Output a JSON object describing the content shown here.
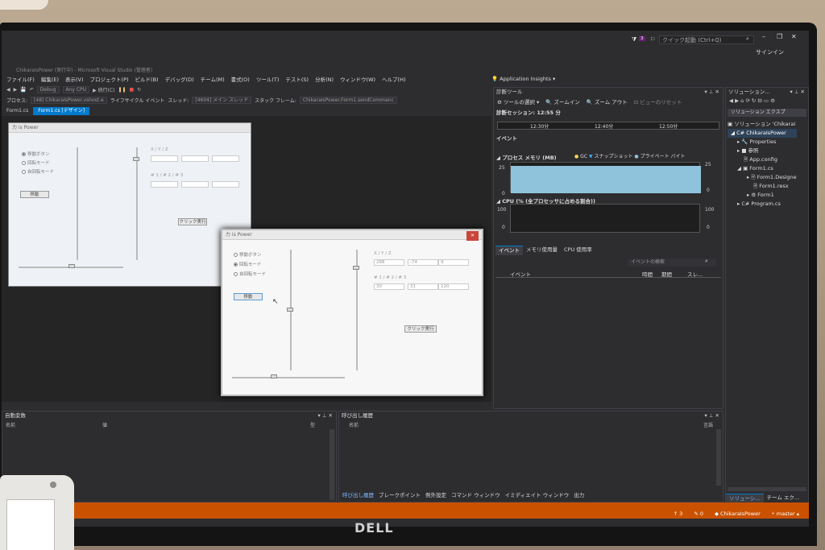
{
  "window": {
    "title": "ChikaraIsPower (実行中) - Microsoft Visual Studio (管理者)",
    "quick_launch_placeholder": "クイック起動 (Ctrl+Q)",
    "notification_count": "3",
    "signin": "サインイン",
    "controls": [
      "–",
      "❐",
      "✕"
    ]
  },
  "menu": [
    "ファイル(F)",
    "編集(E)",
    "表示(V)",
    "プロジェクト(P)",
    "ビルド(B)",
    "デバッグ(D)",
    "チーム(M)",
    "書式(O)",
    "ツール(T)",
    "テスト(S)",
    "分析(N)",
    "ウィンドウ(W)",
    "ヘルプ(H)"
  ],
  "toolbar": {
    "config": "Debug",
    "platform": "Any CPU",
    "continue": "続行(C)",
    "app_insights": "Application Insights"
  },
  "process_bar": {
    "process_label": "プロセス:",
    "process_value": "[48] ChikaraIsPower.vshost.e",
    "lifecycle": "ライフサイクル イベント",
    "thread_label": "スレッド:",
    "thread_value": "[4604] メイン スレッド",
    "stack_label": "スタック フレーム:",
    "stack_value": "ChikaraIsPower.Form1.sendCommanc"
  },
  "tabs": [
    {
      "label": "Form1.cs",
      "active": false
    },
    {
      "label": "Form1.cs [デザイン]",
      "active": true
    }
  ],
  "form_designer": {
    "caption": "力 is Power",
    "radios": [
      "移動ボタン",
      "回転モード",
      "自回転モード"
    ],
    "button_move": "移動",
    "button_click": "クリック実行",
    "label_xyz": "X / Y / Z",
    "label_123": "# 1 / # 2 / # 3"
  },
  "form_running": {
    "caption": "力 is Power",
    "radios": [
      "移動ボタン",
      "回転モード",
      "自回転モード"
    ],
    "button_move": "移動",
    "button_click": "クリック実行",
    "label_xyz": "X / Y / Z",
    "label_123": "# 1 / # 2 / # 3",
    "xyz_values": [
      "288",
      "-74",
      "9"
    ],
    "n_values": [
      "30",
      "31",
      "120"
    ]
  },
  "diagnostics": {
    "title": "診断ツール",
    "tool_select": "ツールの選択",
    "zoom_in": "ズームイン",
    "zoom_out": "ズーム アウト",
    "reset_view": "ビューのリセット",
    "session": "診断セッション: 12:55 分",
    "timeline": [
      "12:30分",
      "12:40分",
      "12:50分"
    ],
    "events_section": "イベント",
    "memory_section": "プロセス メモリ (MB)",
    "legend_gc": "GC",
    "legend_snapshot": "スナップショット",
    "legend_private": "プライベート バイト",
    "mem_max": "25",
    "mem_min": "0",
    "cpu_section": "CPU (% (全プロセッサに占める割合))",
    "cpu_max": "100",
    "cpu_min": "0",
    "subtabs": [
      "イベント",
      "メモリ使用量",
      "CPU 使用率"
    ],
    "search_placeholder": "イベントの検索",
    "columns": [
      "イベント",
      "時間",
      "期間",
      "スレ..."
    ]
  },
  "solution_explorer": {
    "title": "ソリューション...",
    "search_title": "ソリューション エクスプ",
    "items": [
      "ソリューション 'ChikaraI",
      "ChikaraIsPower",
      "Properties",
      "参照",
      "App.config",
      "Form1.cs",
      "Form1.Designe",
      "Form1.resx",
      "Form1",
      "Program.cs"
    ],
    "bottom_tabs": [
      "ソリューシ...",
      "チーム エク..."
    ]
  },
  "locals": {
    "title": "自動変数",
    "columns": [
      "名前",
      "値",
      "型"
    ]
  },
  "callstack": {
    "title": "呼び出し履歴",
    "columns": [
      "名前",
      "言語"
    ]
  },
  "bottom_tabs": [
    "呼び出し履歴",
    "ブレークポイント",
    "例外設定",
    "コマンド ウィンドウ",
    "イミディエイト ウィンドウ",
    "出力"
  ],
  "status_bar": {
    "up_count": "3",
    "edit_count": "0",
    "project": "ChikaraIsPower",
    "branch": "master"
  },
  "monitor_brand": "DELL",
  "colors": {
    "accent": "#007acc",
    "status": "#ca5100",
    "memory_fill": "#8fc3dc"
  }
}
